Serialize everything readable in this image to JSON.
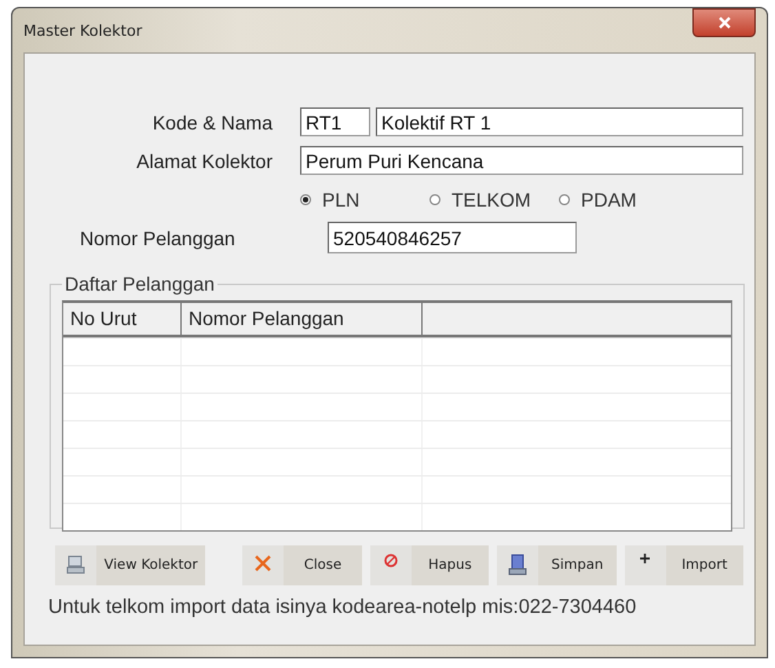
{
  "window": {
    "title": "Master Kolektor"
  },
  "form": {
    "kode_label": "Kode & Nama",
    "kode": "RT1",
    "nama": "Kolektif RT 1",
    "alamat_label": "Alamat Kolektor",
    "alamat": "Perum Puri Kencana",
    "radios": [
      {
        "label": "PLN",
        "selected": true
      },
      {
        "label": "TELKOM",
        "selected": false
      },
      {
        "label": "PDAM",
        "selected": false
      }
    ],
    "nomor_label": "Nomor Pelanggan",
    "nomor": "520540846257"
  },
  "group": {
    "title": "Daftar Pelanggan",
    "table": {
      "columns": [
        "No Urut",
        "Nomor Pelanggan"
      ]
    }
  },
  "buttons": [
    {
      "kind": "view",
      "label": "View Kolektor"
    },
    {
      "kind": "close",
      "label": "Close"
    },
    {
      "kind": "delete",
      "label": "Hapus"
    },
    {
      "kind": "save",
      "label": "Simpan"
    },
    {
      "kind": "import",
      "label": "Import"
    }
  ],
  "note": "Untuk telkom import data isinya kodearea-notelp mis:022-7304460"
}
